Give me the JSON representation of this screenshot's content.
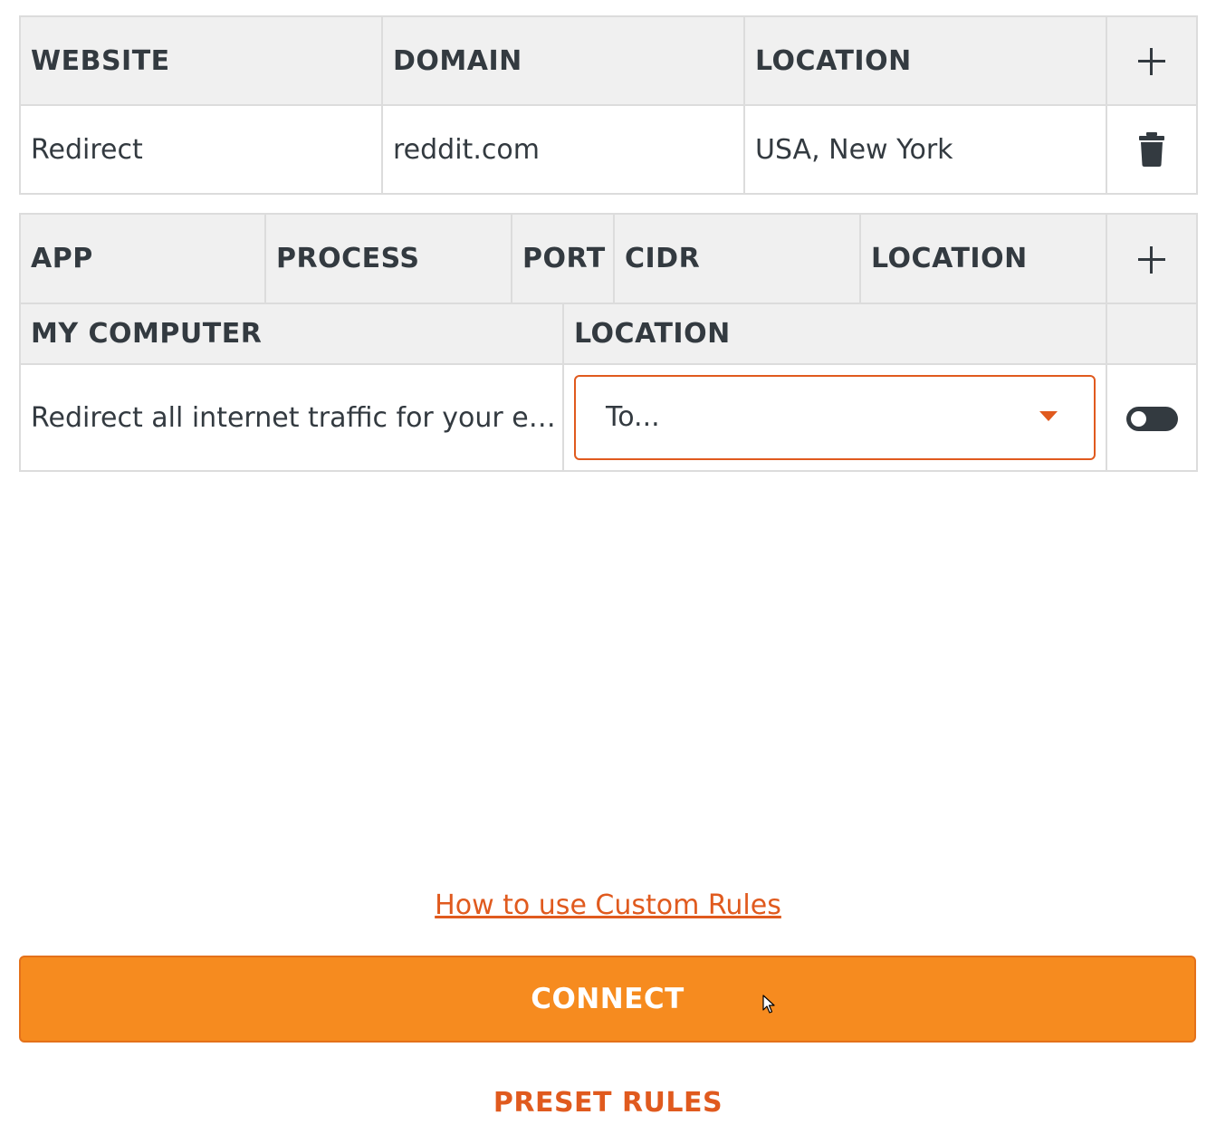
{
  "website_rules": {
    "headers": {
      "website": "WEBSITE",
      "domain": "DOMAIN",
      "location": "LOCATION"
    },
    "rows": [
      {
        "website": "Redirect",
        "domain": "reddit.com",
        "location": "USA, New York"
      }
    ]
  },
  "app_rules": {
    "headers": {
      "app": "APP",
      "process": "PROCESS",
      "port": "PORT",
      "cidr": "CIDR",
      "location": "LOCATION"
    }
  },
  "computer_rules": {
    "headers": {
      "my_computer": "MY COMPUTER",
      "location": "LOCATION"
    },
    "row": {
      "description": "Redirect all internet traffic for your entire computer",
      "location_select": "To...",
      "enabled": false
    }
  },
  "help_link": "How to use Custom Rules",
  "connect_label": "CONNECT",
  "preset_label": "PRESET RULES",
  "colors": {
    "accent": "#e05a1e",
    "connect_bg": "#f68b1f",
    "header_bg": "#f0f0f0",
    "text": "#333a40"
  }
}
